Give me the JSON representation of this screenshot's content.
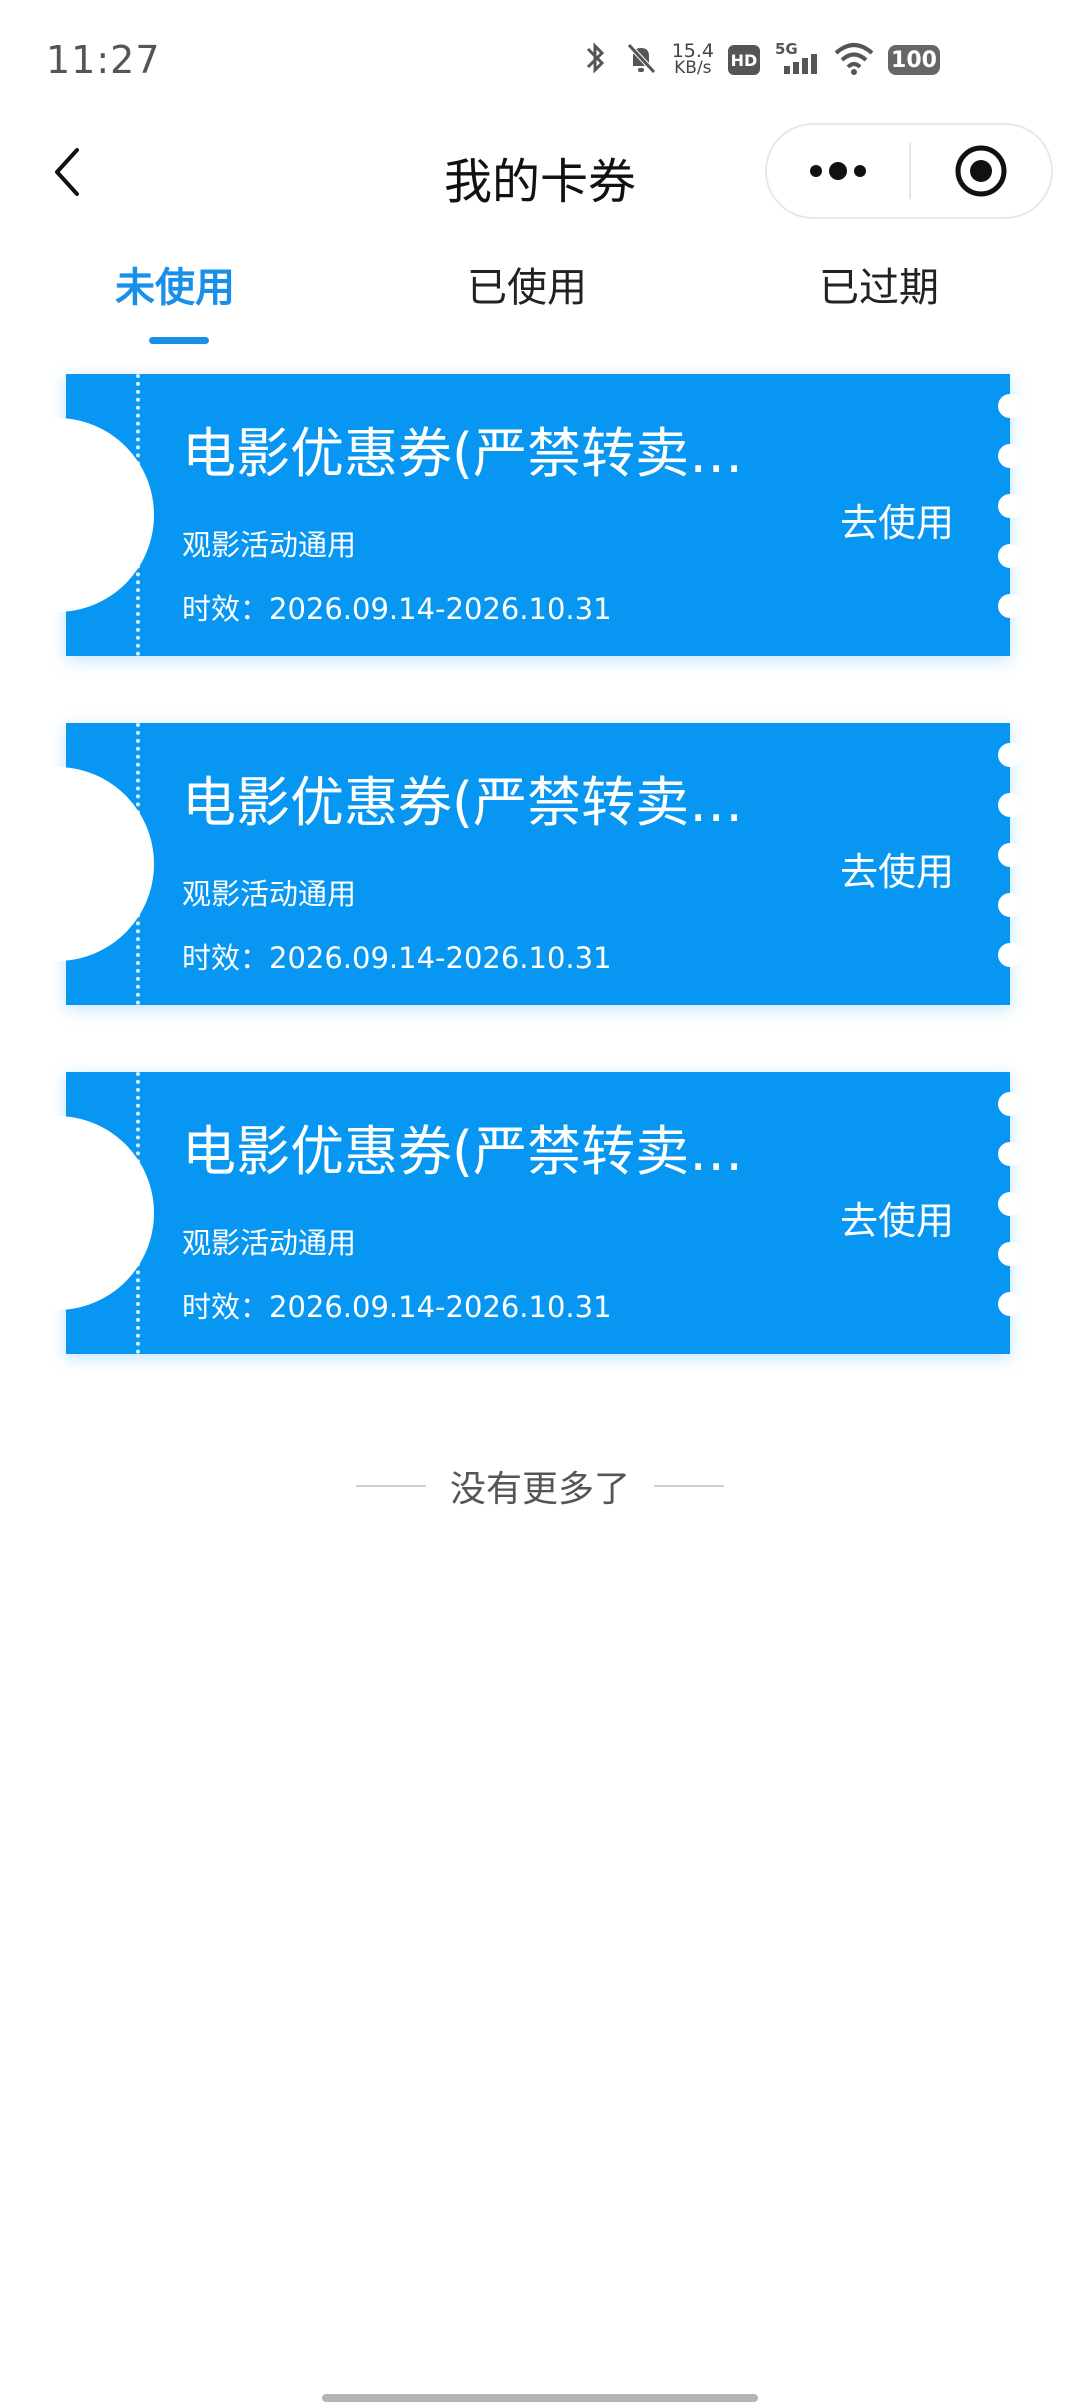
{
  "status_bar": {
    "time": "11:27",
    "net_speed_value": "15.4",
    "net_speed_unit": "KB/s",
    "hd_label": "HD",
    "network_label": "5G",
    "battery": "100"
  },
  "nav": {
    "title": "我的卡券"
  },
  "tabs": [
    {
      "label": "未使用",
      "active": true
    },
    {
      "label": "已使用",
      "active": false
    },
    {
      "label": "已过期",
      "active": false
    }
  ],
  "coupons": [
    {
      "title": "电影优惠券(严禁转卖…",
      "subtitle": "观影活动通用",
      "validity": "时效：2026.09.14-2026.10.31",
      "action": "去使用"
    },
    {
      "title": "电影优惠券(严禁转卖…",
      "subtitle": "观影活动通用",
      "validity": "时效：2026.09.14-2026.10.31",
      "action": "去使用"
    },
    {
      "title": "电影优惠券(严禁转卖…",
      "subtitle": "观影活动通用",
      "validity": "时效：2026.09.14-2026.10.31",
      "action": "去使用"
    }
  ],
  "footer": {
    "no_more": "没有更多了"
  },
  "colors": {
    "accent": "#1a8fe8",
    "coupon_bg": "#0797f2"
  }
}
